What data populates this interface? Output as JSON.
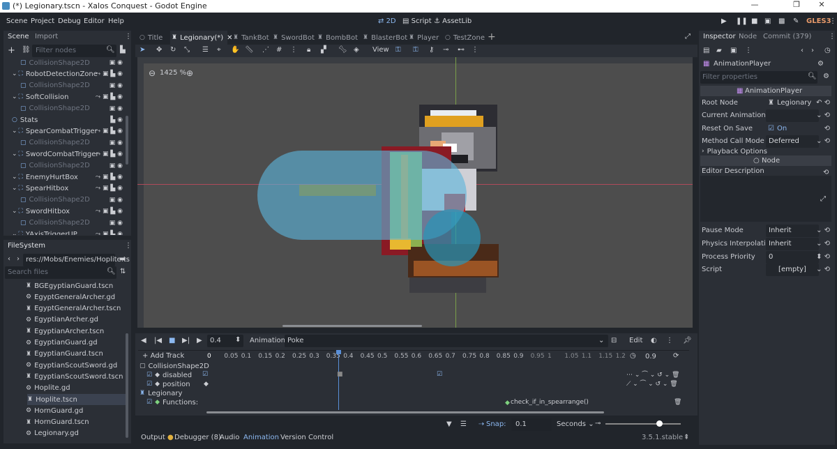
{
  "window": {
    "title": "(*) Legionary.tscn - Xalos Conquest - Godot Engine",
    "min": "—",
    "max": "❐",
    "close": "✕"
  },
  "menu": {
    "items": [
      "Scene",
      "Project",
      "Debug",
      "Editor",
      "Help"
    ]
  },
  "workspaces": {
    "w2d": "2D",
    "script": "Script",
    "assetlib": "AssetLib"
  },
  "renderer": "GLES3",
  "scene_dock": {
    "tabs": [
      "Scene",
      "Import"
    ],
    "filter_placeholder": "Filter nodes",
    "nodes": [
      {
        "label": "CollisionShape2D",
        "kind": "shape",
        "dim": true
      },
      {
        "label": "RobotDetectionZone",
        "kind": "area",
        "dim": false
      },
      {
        "label": "CollisionShape2D",
        "kind": "shape",
        "dim": true
      },
      {
        "label": "SoftCollision",
        "kind": "area",
        "dim": false
      },
      {
        "label": "CollisionShape2D",
        "kind": "shape",
        "dim": true
      },
      {
        "label": "Stats",
        "kind": "node",
        "dim": false
      },
      {
        "label": "SpearCombatTrigger",
        "kind": "area",
        "dim": false
      },
      {
        "label": "CollisionShape2D",
        "kind": "shape",
        "dim": true
      },
      {
        "label": "SwordCombatTrigger",
        "kind": "area",
        "dim": false
      },
      {
        "label": "CollisionShape2D",
        "kind": "shape",
        "dim": true
      },
      {
        "label": "EnemyHurtBox",
        "kind": "area",
        "dim": false
      },
      {
        "label": "SpearHitbox",
        "kind": "area",
        "dim": false
      },
      {
        "label": "CollisionShape2D",
        "kind": "shape",
        "dim": true
      },
      {
        "label": "SwordHitbox",
        "kind": "area",
        "dim": false
      },
      {
        "label": "CollisionShape2D",
        "kind": "shape",
        "dim": true
      },
      {
        "label": "YAxisTriggerUP",
        "kind": "area",
        "dim": false
      }
    ]
  },
  "filesystem": {
    "title": "FileSystem",
    "path": "res://Mobs/Enemies/Hoplite.ts",
    "search_placeholder": "Search files",
    "files": [
      {
        "name": "BGEgyptianGuard.tscn",
        "type": "scene",
        "selected": false
      },
      {
        "name": "EgyptGeneralArcher.gd",
        "type": "script",
        "selected": false
      },
      {
        "name": "EgyptGeneralArcher.tscn",
        "type": "scene",
        "selected": false
      },
      {
        "name": "EgyptianArcher.gd",
        "type": "script",
        "selected": false
      },
      {
        "name": "EgyptianArcher.tscn",
        "type": "scene",
        "selected": false
      },
      {
        "name": "EgyptianGuard.gd",
        "type": "script",
        "selected": false
      },
      {
        "name": "EgyptianGuard.tscn",
        "type": "scene",
        "selected": false
      },
      {
        "name": "EgyptianScoutSword.gd",
        "type": "script",
        "selected": false
      },
      {
        "name": "EgyptianScoutSword.tscn",
        "type": "scene",
        "selected": false
      },
      {
        "name": "Hoplite.gd",
        "type": "script",
        "selected": false
      },
      {
        "name": "Hoplite.tscn",
        "type": "scene",
        "selected": true
      },
      {
        "name": "HornGuard.gd",
        "type": "script",
        "selected": false
      },
      {
        "name": "HornGuard.tscn",
        "type": "scene",
        "selected": false
      },
      {
        "name": "Legionary.gd",
        "type": "script",
        "selected": false
      }
    ]
  },
  "scene_tabs": [
    "Title",
    "Legionary(*)",
    "TankBot",
    "SwordBot",
    "BombBot",
    "BlasterBot",
    "Player",
    "TestZone"
  ],
  "toolbar": {
    "view": "View"
  },
  "viewport": {
    "zoom": "1425 %"
  },
  "animation": {
    "time": "0.4",
    "anim_label": "Animation",
    "anim_name": "Poke",
    "edit": "Edit",
    "add_track": "Add Track",
    "length": "0.9",
    "ticks": [
      "0",
      "0.05",
      "0.1",
      "0.15",
      "0.2",
      "0.25",
      "0.3",
      "0.35",
      "0.4",
      "0.45",
      "0.5",
      "0.55",
      "0.6",
      "0.65",
      "0.7",
      "0.75",
      "0.8",
      "0.85",
      "0.9",
      "0.95",
      "1",
      "1.05",
      "1.1",
      "1.15",
      "1.2"
    ],
    "tracks": {
      "group1": "CollisionShape2D",
      "t1": "disabled",
      "t2": "position",
      "group2": "Legionary",
      "t3": "Functions:",
      "func_key": "check_if_in_spearrange()"
    },
    "snap_label": "Snap:",
    "snap": "0.1",
    "unit": "Seconds"
  },
  "bottom_tabs": {
    "output": "Output",
    "debugger": "Debugger (8)",
    "audio": "Audio",
    "animation": "Animation",
    "vc": "Version Control"
  },
  "version": "3.5.1.stable",
  "inspector": {
    "tabs": [
      "Inspector",
      "Node",
      "Commit (379)"
    ],
    "object": "AnimationPlayer",
    "filter_placeholder": "Filter properties",
    "section": "AnimationPlayer",
    "props": [
      {
        "label": "Root Node",
        "value": "Legionary"
      },
      {
        "label": "Current Animation",
        "value": ""
      },
      {
        "label": "Reset On Save",
        "value": "On"
      },
      {
        "label": "Method Call Mode",
        "value": "Deferred"
      }
    ],
    "playback": "Playback Options",
    "node_section": "Node",
    "editor_desc": "Editor Description",
    "props2": [
      {
        "label": "Pause Mode",
        "value": "Inherit"
      },
      {
        "label": "Physics Interpolation",
        "value": "Inherit"
      },
      {
        "label": "Process Priority",
        "value": "0"
      },
      {
        "label": "Script",
        "value": "[empty]"
      }
    ]
  },
  "colors": {
    "accent": "#8cb8f0",
    "bg": "#21252b",
    "panel": "#2b2f36",
    "viewport": "#4d4d4d"
  }
}
